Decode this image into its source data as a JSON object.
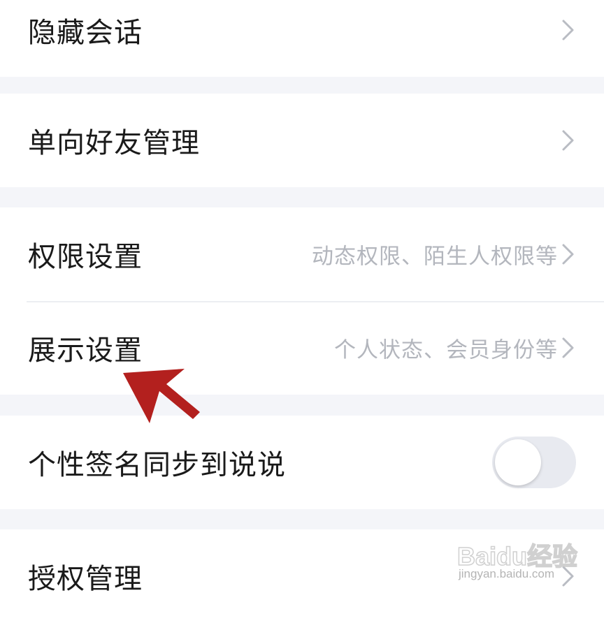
{
  "settings": {
    "hidden_chat": {
      "label": "隐藏会话"
    },
    "one_way_friends": {
      "label": "单向好友管理"
    },
    "permission_settings": {
      "label": "权限设置",
      "value": "动态权限、陌生人权限等"
    },
    "display_settings": {
      "label": "展示设置",
      "value": "个人状态、会员身份等"
    },
    "signature_sync": {
      "label": "个性签名同步到说说",
      "toggle_on": false
    },
    "authorization": {
      "label": "授权管理"
    }
  },
  "watermark": {
    "brand": "Baidu经验",
    "url": "jingyan.baidu.com"
  },
  "colors": {
    "background": "#f4f5f9",
    "row": "#ffffff",
    "label": "#1a1a1a",
    "secondary": "#b3b6bd",
    "arrow": "#b3201e",
    "toggle_track": "#e8eaf0"
  },
  "icons": {
    "chevron": "chevron-right-icon",
    "annotation": "arrow-pointer-icon"
  }
}
